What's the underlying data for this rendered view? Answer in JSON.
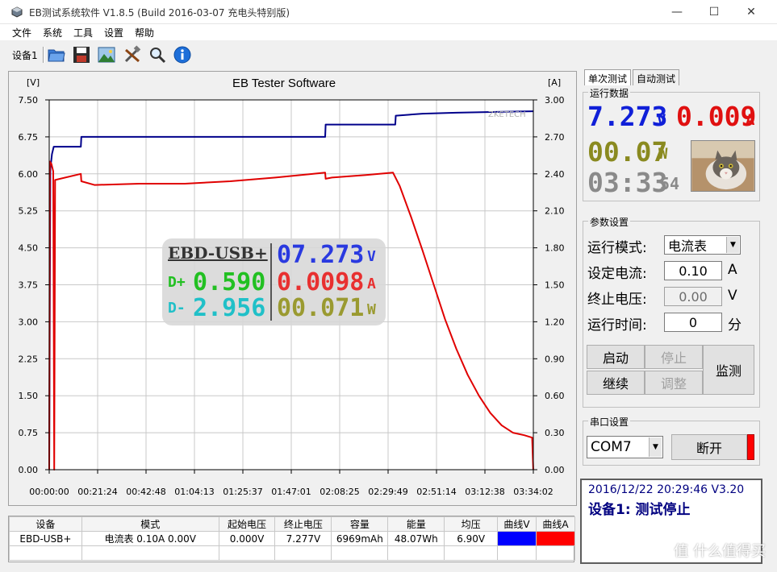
{
  "window": {
    "title": "EB测试系统软件 V1.8.5 (Build 2016-03-07 充电头特别版)",
    "minimize": "—",
    "maximize": "☐",
    "close": "✕"
  },
  "menu": [
    "文件",
    "系统",
    "工具",
    "设置",
    "帮助"
  ],
  "toolbar": {
    "device_label": "设备1",
    "icons": [
      "folder-icon",
      "save-icon",
      "image-icon",
      "tools-icon",
      "search-icon",
      "info-icon"
    ]
  },
  "chart_data": {
    "type": "line",
    "title": "EB Tester Software",
    "y_left_unit": "[V]",
    "y_right_unit": "[A]",
    "ylim_left": [
      0,
      7.5
    ],
    "ylim_right": [
      0,
      3.0
    ],
    "y_left_ticks": [
      "7.50",
      "6.75",
      "6.00",
      "5.25",
      "4.50",
      "3.75",
      "3.00",
      "2.25",
      "1.50",
      "0.75",
      "0.00"
    ],
    "y_right_ticks": [
      "3.00",
      "2.70",
      "2.40",
      "2.10",
      "1.80",
      "1.50",
      "1.20",
      "0.90",
      "0.60",
      "0.30",
      "0.00"
    ],
    "x_ticks": [
      "00:00:00",
      "00:21:24",
      "00:42:48",
      "01:04:13",
      "01:25:37",
      "01:47:01",
      "02:08:25",
      "02:29:49",
      "02:51:14",
      "03:12:38",
      "03:34:02"
    ],
    "x_range_minutes": [
      0,
      214.03
    ],
    "grid": true,
    "brand_label": "ZKETECH",
    "series": [
      {
        "name": "曲线V",
        "color": "#00008b",
        "axis": "left",
        "points": [
          [
            0,
            0.0
          ],
          [
            0.5,
            6.1
          ],
          [
            1.2,
            6.4
          ],
          [
            2,
            6.55
          ],
          [
            14,
            6.55
          ],
          [
            14.2,
            6.75
          ],
          [
            122,
            6.75
          ],
          [
            122.2,
            7.0
          ],
          [
            153,
            7.0
          ],
          [
            153.2,
            7.18
          ],
          [
            165,
            7.22
          ],
          [
            180,
            7.24
          ],
          [
            200,
            7.26
          ],
          [
            214,
            7.27
          ]
        ]
      },
      {
        "name": "曲线A",
        "color": "#e00000",
        "axis": "right",
        "points": [
          [
            0,
            0.0
          ],
          [
            0.3,
            2.5
          ],
          [
            1,
            2.48
          ],
          [
            1.8,
            2.42
          ],
          [
            2.2,
            0.0
          ],
          [
            2.6,
            2.35
          ],
          [
            14,
            2.4
          ],
          [
            14.2,
            2.34
          ],
          [
            20,
            2.31
          ],
          [
            40,
            2.32
          ],
          [
            60,
            2.32
          ],
          [
            80,
            2.34
          ],
          [
            100,
            2.37
          ],
          [
            122,
            2.41
          ],
          [
            122.2,
            2.36
          ],
          [
            125,
            2.37
          ],
          [
            140,
            2.39
          ],
          [
            152,
            2.41
          ],
          [
            155,
            2.3
          ],
          [
            160,
            2.05
          ],
          [
            165,
            1.78
          ],
          [
            170,
            1.5
          ],
          [
            175,
            1.22
          ],
          [
            180,
            0.98
          ],
          [
            185,
            0.77
          ],
          [
            190,
            0.6
          ],
          [
            195,
            0.46
          ],
          [
            200,
            0.36
          ],
          [
            205,
            0.3
          ],
          [
            210,
            0.28
          ],
          [
            213.5,
            0.26
          ],
          [
            214,
            0.0
          ]
        ]
      }
    ]
  },
  "overlay": {
    "device_name": "EBD-USB+",
    "dp_label": "D+",
    "dp_value": "0.590",
    "dm_label": "D-",
    "dm_value": "2.956",
    "voltage": "07.273",
    "voltage_unit": "V",
    "current": "0.0098",
    "current_unit": "A",
    "power": "00.071",
    "power_unit": "W"
  },
  "stats": {
    "headers": [
      "设备",
      "模式",
      "起始电压",
      "终止电压",
      "容量",
      "能量",
      "均压",
      "曲线V",
      "曲线A"
    ],
    "row": [
      "EBD-USB+",
      "电流表  0.10A  0.00V",
      "0.000V",
      "7.277V",
      "6969mAh",
      "48.07Wh",
      "6.90V"
    ],
    "curve_v_color": "#0000ff",
    "curve_a_color": "#ff0000"
  },
  "right": {
    "tabs": [
      "单次测试",
      "自动测试"
    ],
    "run_data_title": "运行数据",
    "voltage": "7.273",
    "voltage_unit": "V",
    "current": "0.009",
    "current_unit": "A",
    "power": "00.07",
    "power_unit": "W",
    "time": "03:33",
    "time_sec": "54",
    "params_title": "参数设置",
    "mode_label": "运行模式:",
    "mode_value": "电流表",
    "current_set_label": "设定电流:",
    "current_set_value": "0.10",
    "current_set_unit": "A",
    "stop_voltage_label": "终止电压:",
    "stop_voltage_value": "0.00",
    "stop_voltage_unit": "V",
    "run_time_label": "运行时间:",
    "run_time_value": "0",
    "run_time_unit": "分",
    "btn_start": "启动",
    "btn_stop": "停止",
    "btn_continue": "继续",
    "btn_adjust": "调整",
    "btn_monitor": "监测",
    "serial_title": "串口设置",
    "com_value": "COM7",
    "btn_disconnect": "断开",
    "status_line1": "2016/12/22 20:29:46  V3.20",
    "status_line2": "设备1: 测试停止",
    "watermark": "值 什么值得买"
  }
}
